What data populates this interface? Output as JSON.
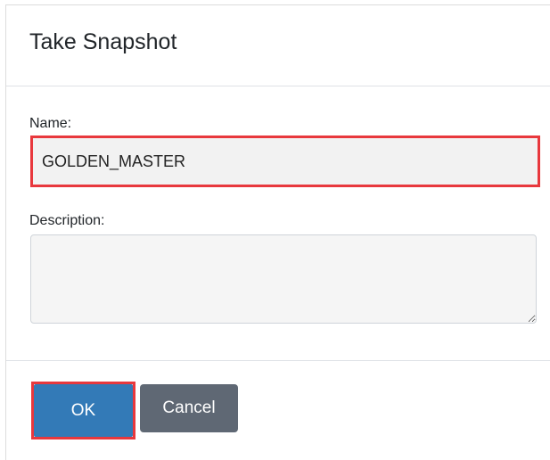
{
  "dialog": {
    "title": "Take Snapshot"
  },
  "form": {
    "name_label": "Name:",
    "name_value": "GOLDEN_MASTER",
    "description_label": "Description:",
    "description_value": ""
  },
  "footer": {
    "ok_label": "OK",
    "cancel_label": "Cancel"
  },
  "colors": {
    "highlight": "#e8383d",
    "ok_button": "#337ab7",
    "cancel_button": "#5f6874"
  }
}
